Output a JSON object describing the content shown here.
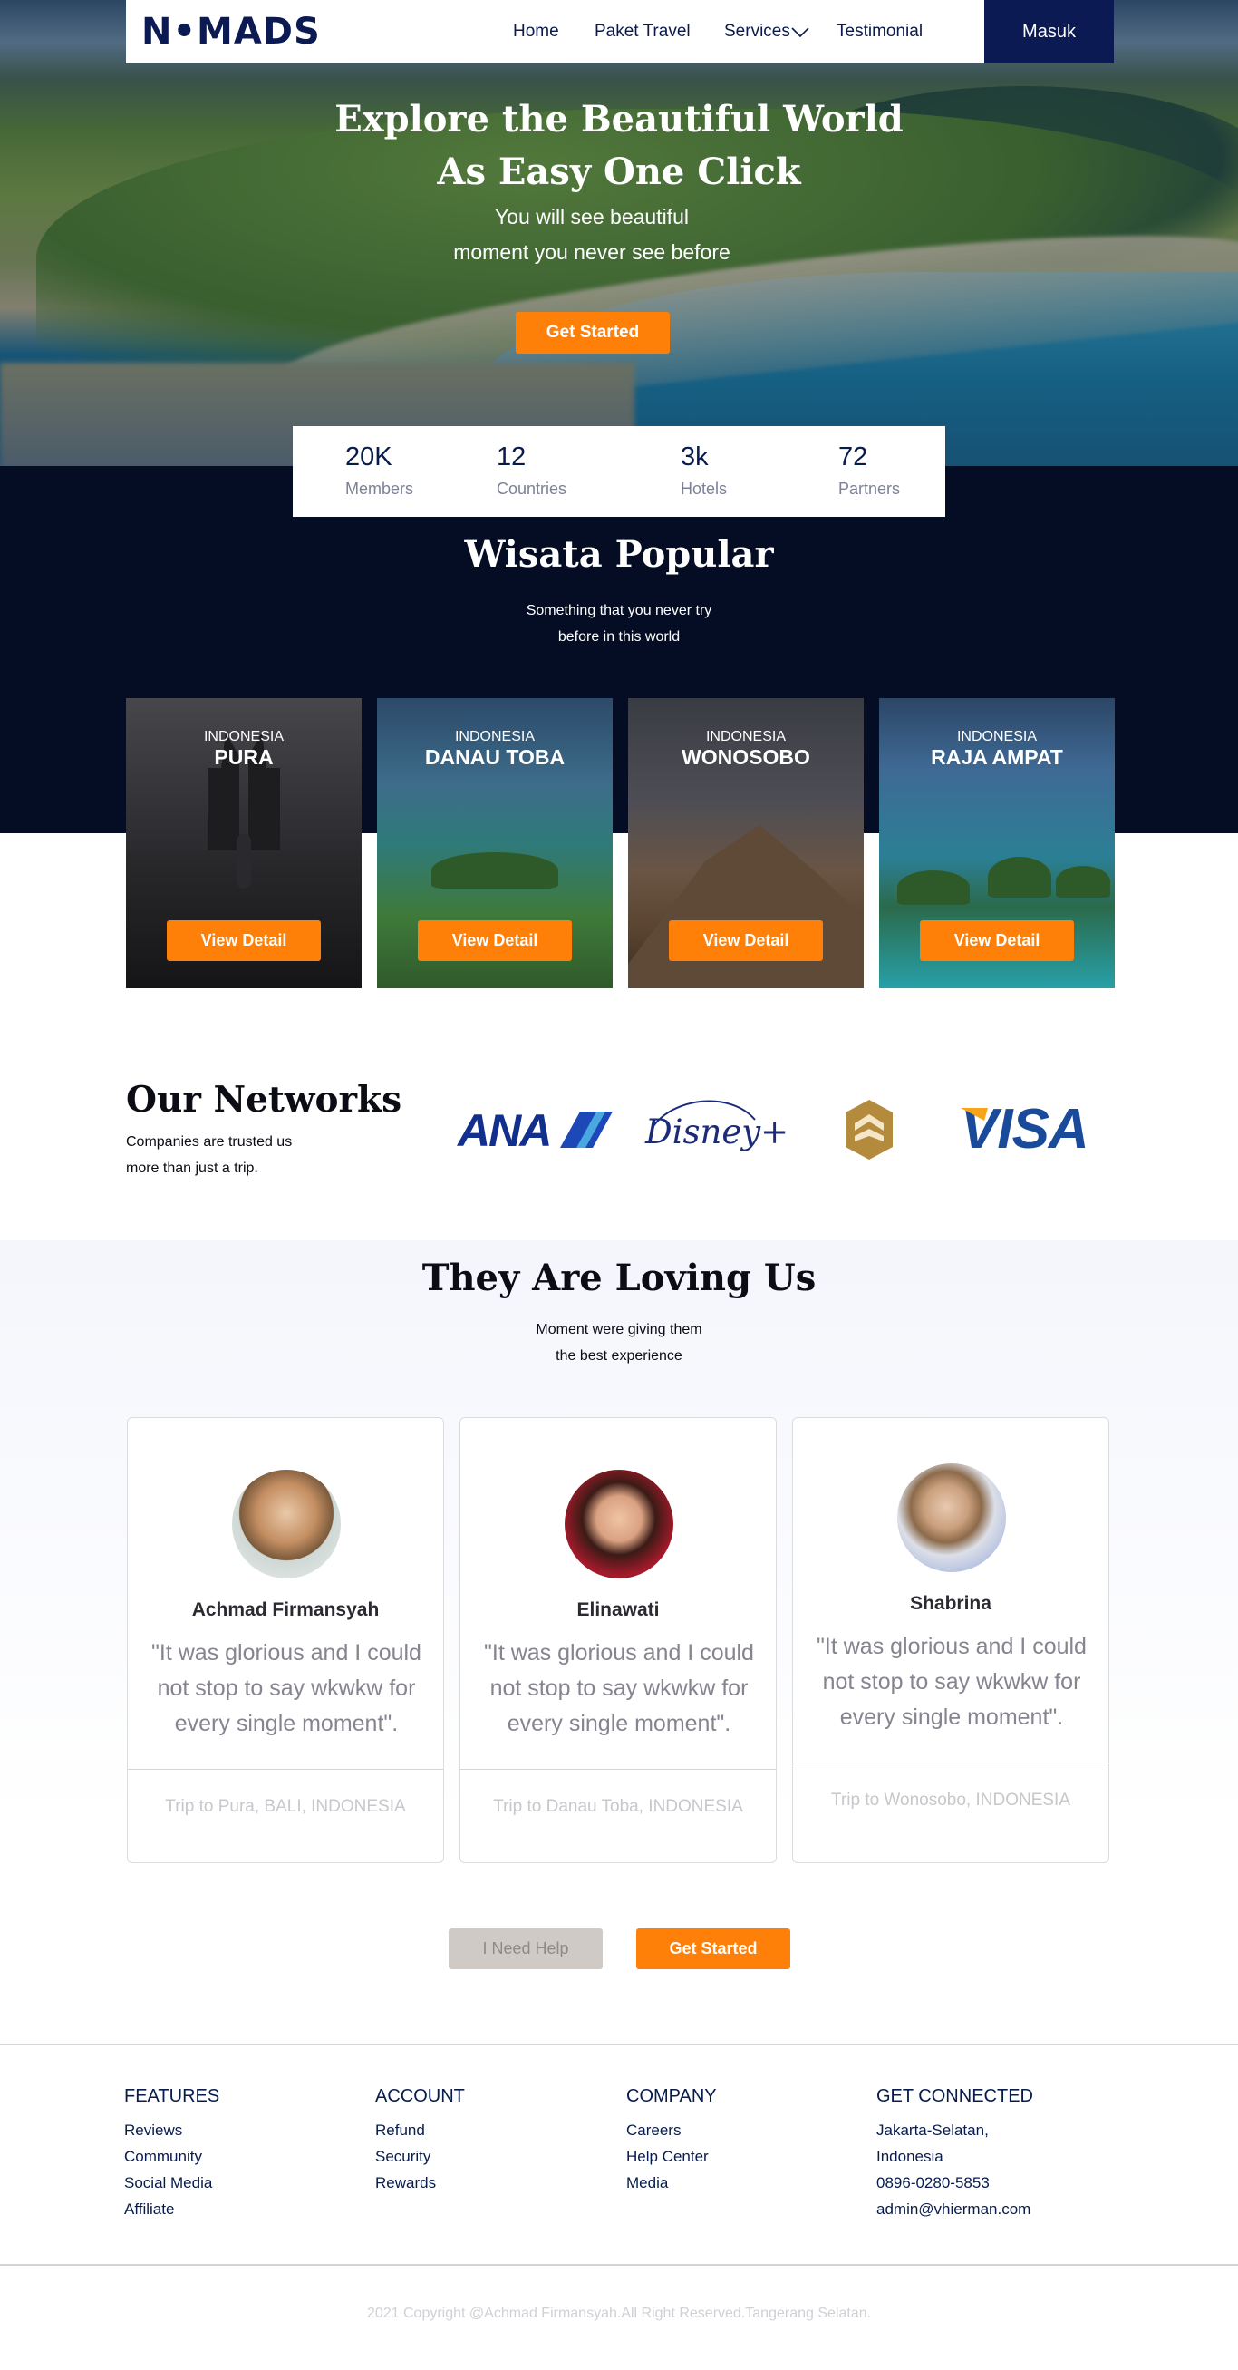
{
  "nav": {
    "logo": "N•MADS",
    "links": [
      "Home",
      "Paket Travel",
      "Services",
      "Testimonial"
    ],
    "login": "Masuk"
  },
  "hero": {
    "title_line1": "Explore the Beautiful World",
    "title_line2": "As Easy One Click",
    "sub_line1": "You will see beautiful",
    "sub_line2": "moment you never see before",
    "cta": "Get Started"
  },
  "stats": [
    {
      "value": "20K",
      "label": "Members"
    },
    {
      "value": "12",
      "label": "Countries"
    },
    {
      "value": "3k",
      "label": "Hotels"
    },
    {
      "value": "72",
      "label": "Partners"
    }
  ],
  "popular": {
    "title": "Wisata Popular",
    "sub_line1": "Something that you never try",
    "sub_line2": "before in this world",
    "cards": [
      {
        "country": "INDONESIA",
        "name": "PURA",
        "button": "View Detail"
      },
      {
        "country": "INDONESIA",
        "name": "DANAU TOBA",
        "button": "View Detail"
      },
      {
        "country": "INDONESIA",
        "name": "WONOSOBO",
        "button": "View Detail"
      },
      {
        "country": "INDONESIA",
        "name": "RAJA AMPAT",
        "button": "View Detail"
      }
    ]
  },
  "networks": {
    "title": "Our Networks",
    "sub_line1": "Companies are trusted us",
    "sub_line2": "more than just a trip.",
    "logos": {
      "ana": "ANA",
      "disney": "Disney+",
      "visa": "VISA"
    }
  },
  "testimonials": {
    "title": "They Are Loving Us",
    "sub_line1": "Moment were giving them",
    "sub_line2": "the best experience",
    "items": [
      {
        "name": "Achmad Firmansyah",
        "quote": "\"It was glorious and I could not stop to say wkwkw for every single moment\".",
        "trip": "Trip to Pura, BALI, INDONESIA"
      },
      {
        "name": "Elinawati",
        "quote": "\"It was glorious and I could not stop to say wkwkw for every single moment\".",
        "trip": "Trip to Danau Toba, INDONESIA"
      },
      {
        "name": "Shabrina",
        "quote": "\"It was glorious and I could not stop to say wkwkw for every single moment\".",
        "trip": "Trip to Wonosobo, INDONESIA"
      }
    ],
    "help_button": "I Need Help",
    "start_button": "Get Started"
  },
  "footer": {
    "columns": [
      {
        "heading": "FEATURES",
        "items": [
          "Reviews",
          "Community",
          "Social Media",
          "Affiliate"
        ]
      },
      {
        "heading": "ACCOUNT",
        "items": [
          "Refund",
          "Security",
          "Rewards"
        ]
      },
      {
        "heading": "COMPANY",
        "items": [
          "Careers",
          "Help Center",
          "Media"
        ]
      },
      {
        "heading": "GET CONNECTED",
        "items": [
          "Jakarta-Selatan,",
          "Indonesia",
          "0896-0280-5853",
          "admin@vhierman.com"
        ]
      }
    ],
    "copyright": "2021 Copyright @Achmad Firmansyah.All Right Reserved.Tangerang Selatan."
  },
  "colors": {
    "navy": "#0b1a53",
    "orange": "#ff8009",
    "dark_section": "#040d24"
  }
}
